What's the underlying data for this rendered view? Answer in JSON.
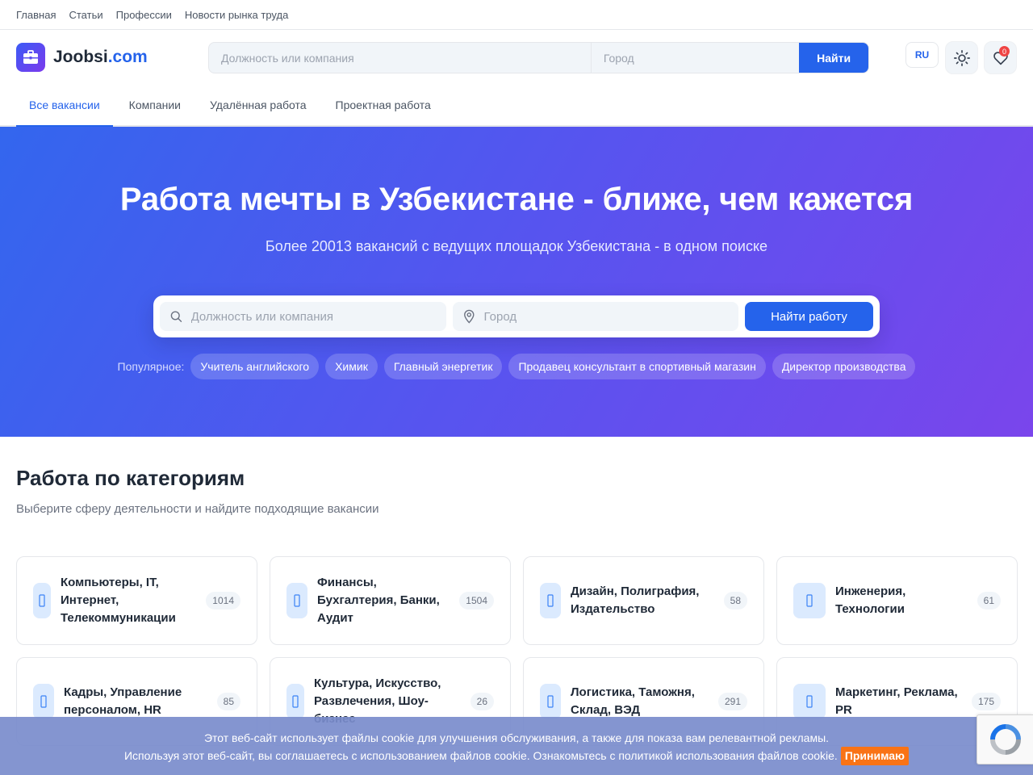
{
  "top_links": [
    "Главная",
    "Статьи",
    "Профессии",
    "Новости рынка труда"
  ],
  "brand": {
    "name": "Joobsi",
    "domain": ".com"
  },
  "header_search": {
    "query_placeholder": "Должность или компания",
    "city_placeholder": "Город",
    "button_label": "Найти"
  },
  "lang": "RU",
  "favorites_count": "0",
  "nav_tabs": [
    "Все вакансии",
    "Компании",
    "Удалённая работа",
    "Проектная работа"
  ],
  "hero": {
    "title": "Работа мечты в Узбекистане - ближе, чем кажется",
    "subtitle": "Более 20013 вакансий с ведущих площадок Узбекистана - в одном поиске",
    "query_placeholder": "Должность или компания",
    "city_placeholder": "Город",
    "button_label": "Найти работу",
    "popular_label": "Популярное:",
    "popular": [
      "Учитель английского",
      "Химик",
      "Главный энергетик",
      "Продавец консультант в спортивный магазин",
      "Директор производства"
    ]
  },
  "categories": {
    "title": "Работа по категориям",
    "subtitle": "Выберите сферу деятельности и найдите подходящие вакансии",
    "items": [
      {
        "name": "Компьютеры, IT, Интернет, Телекоммуникации",
        "count": "1014"
      },
      {
        "name": "Финансы, Бухгалтерия, Банки, Аудит",
        "count": "1504"
      },
      {
        "name": "Дизайн, Полиграфия, Издательство",
        "count": "58"
      },
      {
        "name": "Инженерия, Технологии",
        "count": "61"
      },
      {
        "name": "Кадры, Управление персоналом, HR",
        "count": "85"
      },
      {
        "name": "Культура, Искусство, Развлечения, Шоу-бизнес",
        "count": "26"
      },
      {
        "name": "Логистика, Таможня, Склад, ВЭД",
        "count": "291"
      },
      {
        "name": "Маркетинг, Реклама, PR",
        "count": "175"
      }
    ]
  },
  "cookie": {
    "line1": "Этот веб-сайт использует файлы cookie для улучшения обслуживания, а также для показа вам релевантной рекламы.",
    "line2": "Используя этот веб-сайт, вы соглашаетесь с использованием файлов cookie. Ознакомьтесь с политикой использования файлов cookie.",
    "accept_label": "Принимаю"
  },
  "colors": {
    "accent": "#2563eb",
    "hero_start": "#3366ee",
    "hero_end": "#7a45ec",
    "cookie_accept": "#f97316",
    "badge": "#ef4444"
  }
}
